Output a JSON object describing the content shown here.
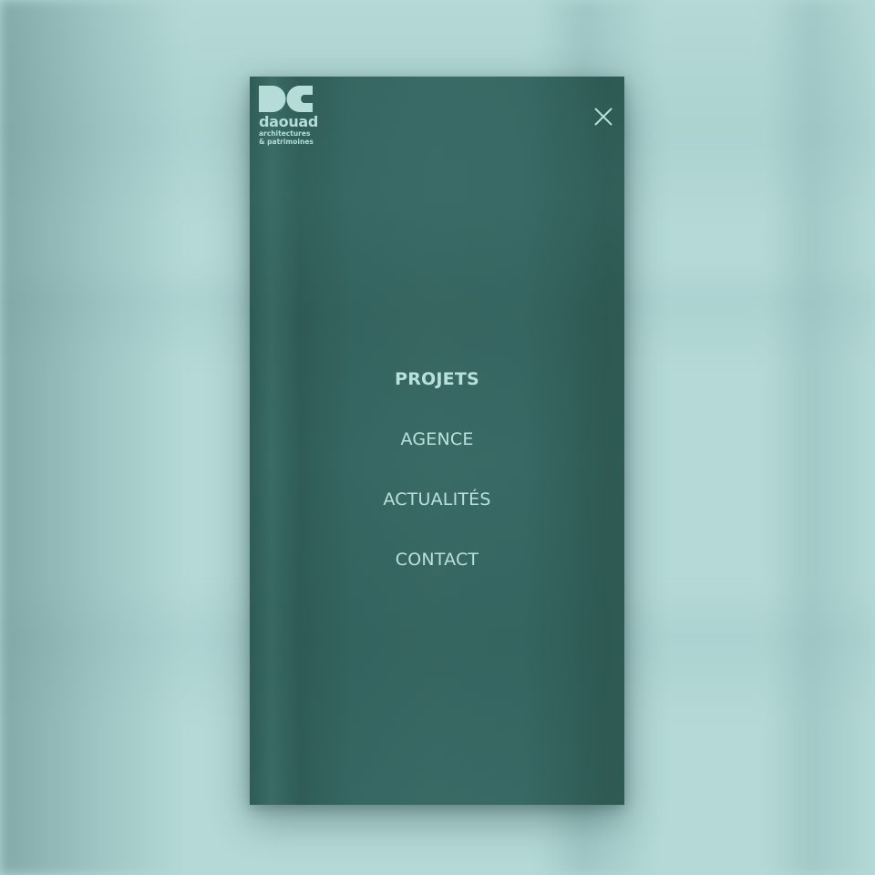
{
  "brand": {
    "name": "daouad",
    "line1": "architectures",
    "line2": "& patrimoines",
    "logo_mark": "dc-logo-icon",
    "color": "#b6dcd8"
  },
  "menu": {
    "close_icon": "close-icon",
    "items": [
      {
        "label": "PROJETS",
        "active": true
      },
      {
        "label": "AGENCE",
        "active": false
      },
      {
        "label": "ACTUALITÉS",
        "active": false
      },
      {
        "label": "CONTACT",
        "active": false
      }
    ]
  },
  "colors": {
    "panel": "#386964",
    "text": "#b9e0dc",
    "background": "#b4d9d7"
  }
}
